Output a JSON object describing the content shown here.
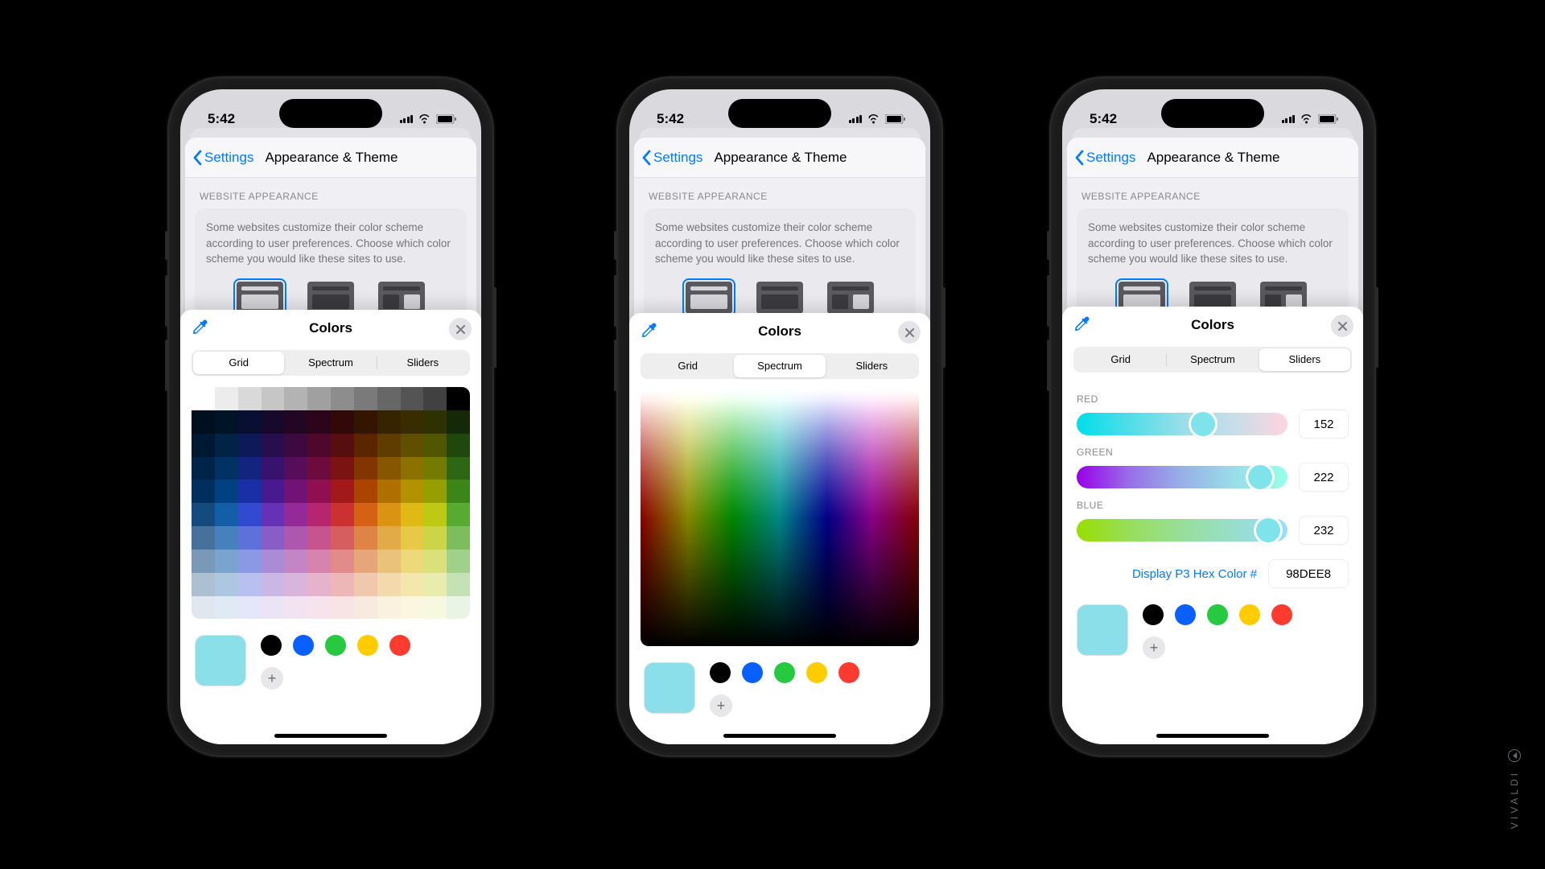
{
  "status": {
    "time": "5:42"
  },
  "settings": {
    "back_label": "Settings",
    "title": "Appearance & Theme",
    "section_header": "WEBSITE APPEARANCE",
    "section_body": "Some websites customize their color scheme according to user preferences. Choose which color scheme you would like these sites to use."
  },
  "picker": {
    "title": "Colors",
    "tabs": {
      "grid": "Grid",
      "spectrum": "Spectrum",
      "sliders": "Sliders"
    }
  },
  "sliders": {
    "red": {
      "label": "RED",
      "value": 152
    },
    "green": {
      "label": "GREEN",
      "value": 222
    },
    "blue": {
      "label": "BLUE",
      "value": 232
    },
    "hex_label": "Display P3 Hex Color #",
    "hex_value": "98DEE8"
  },
  "swatch": {
    "selected": "#8adfe8",
    "presets": [
      "#000000",
      "#0a60ff",
      "#27c940",
      "#ffcc00",
      "#ff3b30"
    ]
  },
  "grid_top_row": [
    "#ffffff",
    "#ececec",
    "#d9d9d9",
    "#c6c6c6",
    "#b3b3b3",
    "#a0a0a0",
    "#8d8d8d",
    "#7a7a7a",
    "#676767",
    "#545454",
    "#414141",
    "#000000"
  ],
  "grid_hues": [
    "#003a73",
    "#0050a0",
    "#1f3acb",
    "#5a1fb0",
    "#8a178f",
    "#b01262",
    "#c61f1f",
    "#d15400",
    "#d88a00",
    "#dcb400",
    "#b8c400",
    "#4aa41f"
  ],
  "brand": "VIVALDI"
}
